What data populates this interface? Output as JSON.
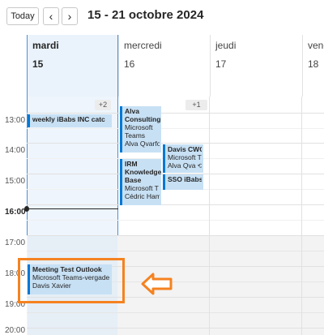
{
  "toolbar": {
    "today_label": "Today",
    "prev_icon": "‹",
    "next_icon": "›",
    "range_title": "15 - 21 octobre 2024"
  },
  "days": [
    {
      "name": "mardi",
      "number": "15",
      "today": true
    },
    {
      "name": "mercredi",
      "number": "16"
    },
    {
      "name": "jeudi",
      "number": "17"
    },
    {
      "name": "vendredi",
      "number": "18"
    }
  ],
  "more_badges": [
    "+2",
    "+1"
  ],
  "time_labels": [
    "13:00",
    "14:00",
    "15:00",
    "16:00",
    "17:00",
    "18:00",
    "19:00",
    "20:00"
  ],
  "current_time": "16:00",
  "events": {
    "weekly": {
      "title": "weekly iBabs INC catc"
    },
    "alva": {
      "title": "Alva Consulting",
      "line1": "Microsoft Teams",
      "line2": "Alva Qvarfo"
    },
    "davis_cwc": {
      "title": "Davis CWC",
      "line1": "Microsoft T",
      "line2": "Alva Qva"
    },
    "irm": {
      "title": "IRM Knowledge Base",
      "line1": "Microsoft T",
      "line2": "Cédric Ham"
    },
    "sso": {
      "title": "SSO iBabs"
    },
    "meeting": {
      "title": "Meeting Test Outlook",
      "line1": "Microsoft Teams-vergade",
      "line2": "Davis Xavier"
    }
  },
  "icons": {
    "recurrence": "recurrence-off-icon",
    "arrow": "arrow-left-icon"
  },
  "colors": {
    "accent": "#0078d4",
    "event_bg": "#c7e0f4",
    "highlight": "#f58220"
  }
}
